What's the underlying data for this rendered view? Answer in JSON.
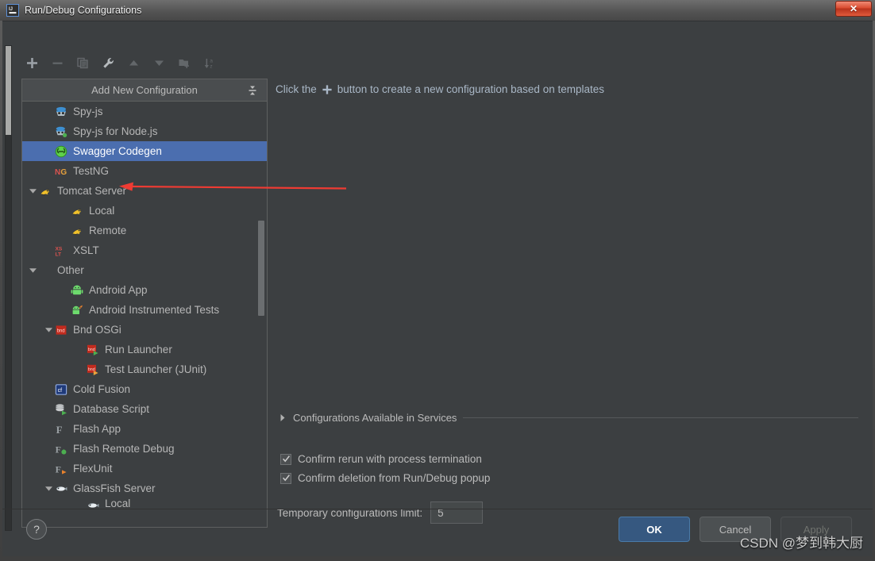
{
  "window": {
    "title": "Run/Debug Configurations",
    "app_icon": "intellij-idea-icon",
    "close_label": "✕"
  },
  "toolbar": {
    "items": [
      {
        "name": "add-configuration-button",
        "icon": "plus-icon",
        "enabled": true
      },
      {
        "name": "remove-configuration-button",
        "icon": "minus-icon",
        "enabled": false
      },
      {
        "name": "copy-configuration-button",
        "icon": "copy-icon",
        "enabled": false
      },
      {
        "name": "edit-templates-button",
        "icon": "wrench-icon",
        "enabled": true
      },
      {
        "name": "move-up-button",
        "icon": "arrow-up-icon",
        "enabled": false
      },
      {
        "name": "move-down-button",
        "icon": "arrow-down-icon",
        "enabled": false
      },
      {
        "name": "create-folder-button",
        "icon": "folder-add-icon",
        "enabled": false
      },
      {
        "name": "sort-configurations-button",
        "icon": "sort-az-icon",
        "enabled": false
      }
    ]
  },
  "tree": {
    "header": {
      "title": "Add New Configuration",
      "action_icon": "collapse-all-icon"
    },
    "items": [
      {
        "label": "Spy-js",
        "indent": 1,
        "icon": "spyjs-icon",
        "twisty": "",
        "selected": false
      },
      {
        "label": "Spy-js for Node.js",
        "indent": 1,
        "icon": "spyjs-node-icon",
        "twisty": "",
        "selected": false
      },
      {
        "label": "Swagger Codegen",
        "indent": 1,
        "icon": "swagger-icon",
        "twisty": "",
        "selected": true
      },
      {
        "label": "TestNG",
        "indent": 1,
        "icon": "testng-icon",
        "twisty": "",
        "selected": false
      },
      {
        "label": "Tomcat Server",
        "indent": 0,
        "icon": "tomcat-icon",
        "twisty": "expanded",
        "selected": false
      },
      {
        "label": "Local",
        "indent": 2,
        "icon": "tomcat-icon",
        "twisty": "",
        "selected": false
      },
      {
        "label": "Remote",
        "indent": 2,
        "icon": "tomcat-icon",
        "twisty": "",
        "selected": false
      },
      {
        "label": "XSLT",
        "indent": 1,
        "icon": "xslt-icon",
        "twisty": "",
        "selected": false
      },
      {
        "label": "Other",
        "indent": 0,
        "icon": "",
        "twisty": "expanded",
        "selected": false
      },
      {
        "label": "Android App",
        "indent": 2,
        "icon": "android-icon",
        "twisty": "",
        "selected": false
      },
      {
        "label": "Android Instrumented Tests",
        "indent": 2,
        "icon": "android-test-icon",
        "twisty": "",
        "selected": false
      },
      {
        "label": "Bnd OSGi",
        "indent": 1,
        "icon": "bnd-icon",
        "twisty": "expanded",
        "selected": false
      },
      {
        "label": "Run Launcher",
        "indent": 3,
        "icon": "bnd-run-icon",
        "twisty": "",
        "selected": false
      },
      {
        "label": "Test Launcher (JUnit)",
        "indent": 3,
        "icon": "bnd-test-icon",
        "twisty": "",
        "selected": false
      },
      {
        "label": "Cold Fusion",
        "indent": 1,
        "icon": "coldfusion-icon",
        "twisty": "",
        "selected": false
      },
      {
        "label": "Database Script",
        "indent": 1,
        "icon": "database-icon",
        "twisty": "",
        "selected": false
      },
      {
        "label": "Flash App",
        "indent": 1,
        "icon": "flash-icon",
        "twisty": "",
        "selected": false
      },
      {
        "label": "Flash Remote Debug",
        "indent": 1,
        "icon": "flash-debug-icon",
        "twisty": "",
        "selected": false
      },
      {
        "label": "FlexUnit",
        "indent": 1,
        "icon": "flexunit-icon",
        "twisty": "",
        "selected": false
      },
      {
        "label": "GlassFish Server",
        "indent": 1,
        "icon": "glassfish-icon",
        "twisty": "expanded",
        "selected": false
      },
      {
        "label": "Local",
        "indent": 3,
        "icon": "glassfish-icon",
        "twisty": "",
        "selected": false
      }
    ]
  },
  "main": {
    "hint_before": "Click the",
    "hint_plus_icon": "plus-icon",
    "hint_after": "button to create a new configuration based on templates",
    "services_section": {
      "label": "Configurations Available in Services",
      "expanded": false,
      "arrow_icon": "chevron-right-icon"
    },
    "options": [
      {
        "label": "Confirm rerun with process termination",
        "checked": true
      },
      {
        "label": "Confirm deletion from Run/Debug popup",
        "checked": true
      }
    ],
    "temp_limit": {
      "label": "Temporary configurations limit:",
      "value": "5"
    }
  },
  "footer": {
    "help_label": "?",
    "buttons": [
      {
        "label": "OK",
        "style": "primary",
        "name": "ok-button"
      },
      {
        "label": "Cancel",
        "style": "normal",
        "name": "cancel-button"
      },
      {
        "label": "Apply",
        "style": "disabled",
        "name": "apply-button"
      }
    ]
  },
  "annotation": {
    "arrow_color": "#ee3b33",
    "points_to": "Local"
  },
  "watermark": {
    "text": "CSDN @梦到韩大厨"
  },
  "colors": {
    "dialog_bg": "#3c3f41",
    "selection": "#4b6eaf",
    "primary_button": "#365880",
    "text": "#bbbbbb",
    "hint_text": "#a9b7c6",
    "annotation_red": "#ee3b33"
  }
}
